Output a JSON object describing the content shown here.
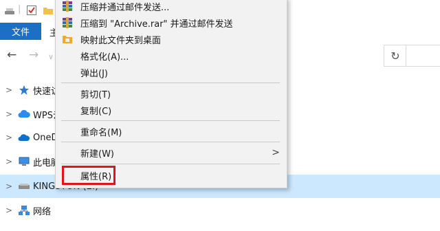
{
  "ribbon": {
    "file_tab": "文件",
    "next_tab": "主"
  },
  "tree": {
    "items": [
      {
        "label": "快速访"
      },
      {
        "label": "WPS云"
      },
      {
        "label": "OneD"
      },
      {
        "label": "此电脑"
      },
      {
        "label": "KINGSTON (E:)"
      },
      {
        "label": "网络"
      }
    ]
  },
  "context_menu": {
    "items": [
      {
        "label": "压缩并通过邮件发送..."
      },
      {
        "label": "压缩到 \"Archive.rar\" 并通过邮件发送"
      },
      {
        "label": "映射此文件夹到桌面"
      },
      {
        "label": "格式化(A)..."
      },
      {
        "label": "弹出(J)"
      },
      {
        "label": "剪切(T)"
      },
      {
        "label": "复制(C)"
      },
      {
        "label": "重命名(M)"
      },
      {
        "label": "新建(W)"
      },
      {
        "label": "属性(R)"
      }
    ]
  },
  "icons": {
    "winrar": "winrar-icon",
    "wps": "wps-folder-icon",
    "star": "star-icon",
    "cloud_wps": "wps-cloud-icon",
    "onedrive": "onedrive-icon",
    "pc": "computer-icon",
    "drive": "usb-drive-icon",
    "network": "network-icon"
  },
  "colors": {
    "file_tab": "#1c6fc4",
    "selection": "#cce8ff",
    "highlight_border": "#e0141b"
  }
}
